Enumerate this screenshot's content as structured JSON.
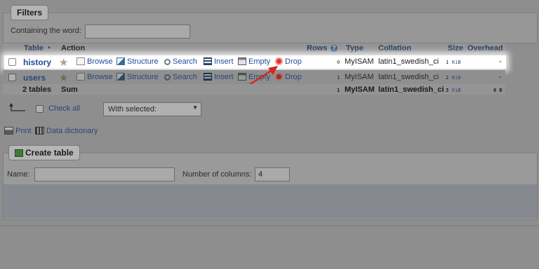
{
  "filters": {
    "legend": "Filters",
    "containing_label": "Containing the word:",
    "containing_value": ""
  },
  "table": {
    "headers": {
      "table": "Table",
      "sort_indicator": "▲",
      "action": "Action",
      "rows": "Rows",
      "rows_help": "?",
      "type": "Type",
      "collation": "Collation",
      "size": "Size",
      "overhead": "Overhead"
    },
    "rows": [
      {
        "name": "history",
        "actions": {
          "browse": "Browse",
          "structure": "Structure",
          "search": "Search",
          "insert": "Insert",
          "empty": "Empty",
          "drop": "Drop"
        },
        "rows": "0",
        "type": "MyISAM",
        "collation": "latin1_swedish_ci",
        "size_num": "1",
        "size_unit": "KiB",
        "overhead": "-"
      },
      {
        "name": "users",
        "actions": {
          "browse": "Browse",
          "structure": "Structure",
          "search": "Search",
          "insert": "Insert",
          "empty": "Empty",
          "drop": "Drop"
        },
        "rows": "1",
        "type": "MyISAM",
        "collation": "latin1_swedish_ci",
        "size_num": "2",
        "size_unit": "KiB",
        "overhead": "-"
      }
    ],
    "footer": {
      "count": "2 tables",
      "sum": "Sum",
      "rows": "1",
      "type": "MyISAM",
      "collation": "latin1_swedish_ci",
      "size_num": "3",
      "size_unit": "KiB",
      "overhead": "0 B"
    }
  },
  "bulk": {
    "check_all": "Check all",
    "with_selected": "With selected:"
  },
  "links": {
    "print": "Print",
    "data_dictionary": "Data dictionary"
  },
  "create_table": {
    "legend": "Create table",
    "name_label": "Name:",
    "name_value": "",
    "columns_label": "Number of columns:",
    "columns_value": "4"
  },
  "colors": {
    "highlight_row": "#ffffff",
    "arrow": "#d8251c",
    "link": "#234b9a"
  }
}
